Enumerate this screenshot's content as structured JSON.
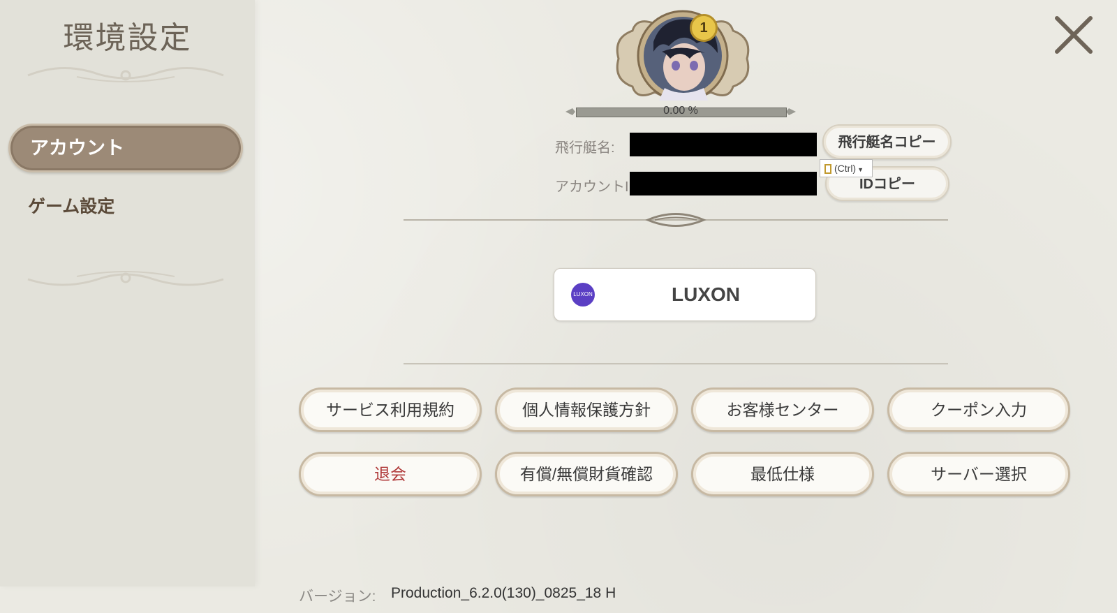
{
  "sidebar": {
    "title": "環境設定",
    "tabs": [
      {
        "label": "アカウント",
        "active": true
      },
      {
        "label": "ゲーム設定",
        "active": false
      }
    ]
  },
  "profile": {
    "level_badge": "1",
    "progress_text": "0.00 %",
    "progress_value": 0.0,
    "pilot_name_label": "飛行艇名:",
    "account_id_label": "アカウントI",
    "copy_name_button": "飛行艇名コピー",
    "copy_id_button": "IDコピー",
    "paste_chip": "(Ctrl)"
  },
  "login": {
    "logo_text": "LUXON",
    "button_label": "LUXON"
  },
  "menu": [
    {
      "label": "サービス利用規約"
    },
    {
      "label": "個人情報保護方針"
    },
    {
      "label": "お客様センター"
    },
    {
      "label": "クーポン入力"
    },
    {
      "label": "退会"
    },
    {
      "label": "有償/無償財貨確認"
    },
    {
      "label": "最低仕様"
    },
    {
      "label": "サーバー選択"
    }
  ],
  "footer": {
    "version_label": "バージョン:",
    "version_value": "Production_6.2.0(130)_0825_18 H"
  },
  "colors": {
    "active_tab": "#9c8a77",
    "danger_text": "#b03a3a",
    "luxon_brand": "#5b3fc4",
    "badge": "#e8c64a"
  }
}
